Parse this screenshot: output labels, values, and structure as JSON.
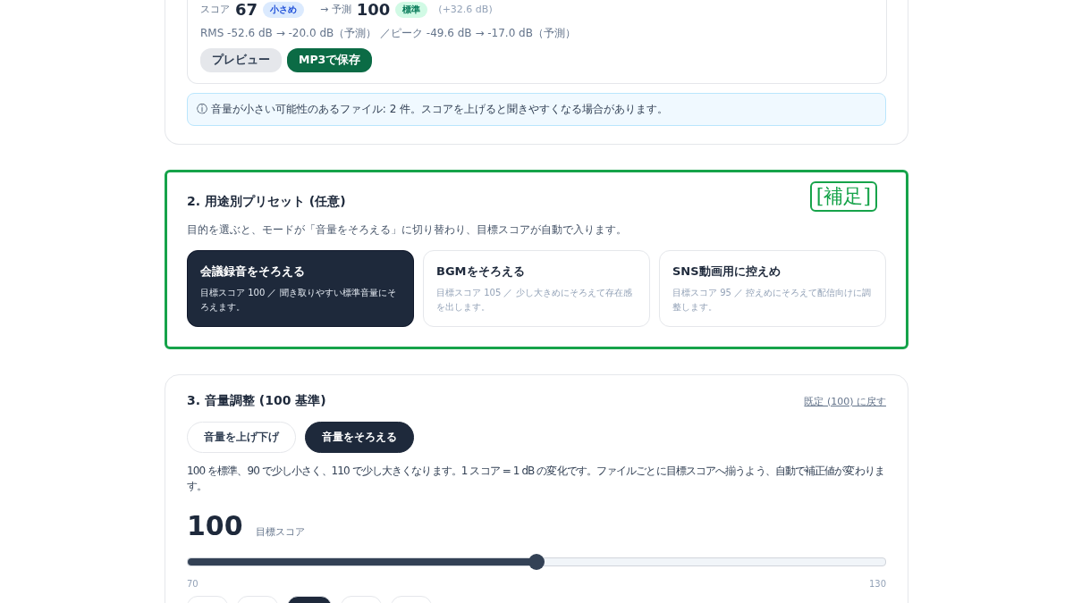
{
  "result_card": {
    "score_label": "スコア",
    "score": "67",
    "score_badge": "小さめ",
    "arrow_label": "→ 予測",
    "predicted": "100",
    "predicted_badge": "標準",
    "gain": "(+32.6 dB)",
    "levels": "RMS -52.6 dB → -20.0 dB（予測） ／ピーク -49.6 dB → -17.0 dB（予測）",
    "buttons": [
      {
        "label": "プレビュー",
        "kind": "secondary"
      },
      {
        "label": "MP3で保存",
        "kind": "primary"
      }
    ],
    "notice": "ⓘ 音量が小さい可能性のあるファイル: 2 件。スコアを上げると聞きやすくなる場合があります。"
  },
  "presets": {
    "title": "2. 用途別プリセット (任意)",
    "note": "[補足]",
    "description": "目的を選ぶと、モードが「音量をそろえる」に切り替わり、目標スコアが自動で入ります。",
    "items": [
      {
        "title": "会議録音をそろえる",
        "description": "目標スコア 100 ／ 聞き取りやすい標準音量にそろえます。",
        "selected": true
      },
      {
        "title": "BGMをそろえる",
        "description": "目標スコア 105 ／ 少し大きめにそろえて存在感を出します。",
        "selected": false
      },
      {
        "title": "SNS動画用に控えめ",
        "description": "目標スコア 95 ／ 控えめにそろえて配信向けに調整します。",
        "selected": false
      }
    ]
  },
  "volume": {
    "title": "3. 音量調整 (100 基準)",
    "reset_link": "既定 (100) に戻す",
    "modes": [
      {
        "label": "音量を上げ下げ",
        "selected": false
      },
      {
        "label": "音量をそろえる",
        "selected": true
      }
    ],
    "description": "100 を標準、90 で少し小さく、110 で少し大きくなります。1 スコア = 1 dB の変化です。ファイルごとに目標スコアへ揃うよう、自動で補正値が変わります。",
    "value": "100",
    "value_label": "目標スコア",
    "slider": {
      "level": 0.5,
      "min_label": "70",
      "max_label": "130"
    },
    "quick_chips": [
      {
        "selected": false
      },
      {
        "selected": false
      },
      {
        "selected": true
      },
      {
        "selected": false
      },
      {
        "selected": false
      }
    ]
  }
}
